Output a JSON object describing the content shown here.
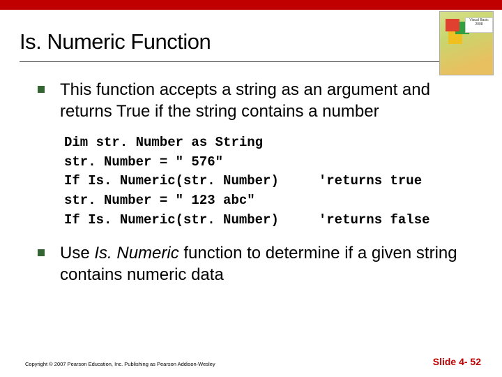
{
  "header": {
    "title": "Is. Numeric Function"
  },
  "book": {
    "brand_line1": "Visual Basic",
    "brand_line2": "2008"
  },
  "bullets": {
    "b1": "This function accepts a string as an argument and returns True if the string contains a number",
    "b2_pre": "Use ",
    "b2_func": "Is. Numeric",
    "b2_post": " function to determine if a given string contains numeric data"
  },
  "code": {
    "l1": "Dim str. Number as String",
    "l2": "str. Number = \" 576\"",
    "l3a": "If Is. Numeric(str. Number)",
    "l3b": "'returns true",
    "l4": "str. Number = \" 123 abc\"",
    "l5a": "If Is. Numeric(str. Number)",
    "l5b": "'returns false"
  },
  "footer": {
    "copyright": "Copyright © 2007 Pearson Education, Inc. Publishing as Pearson Addison-Wesley",
    "slide": "Slide 4- 52"
  }
}
